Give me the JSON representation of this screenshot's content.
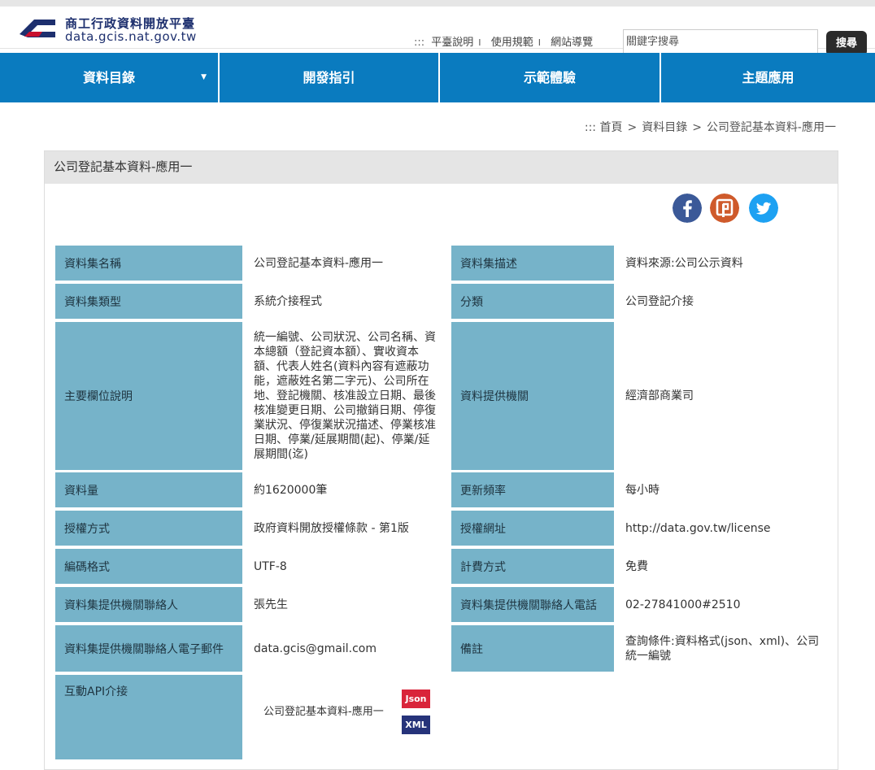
{
  "site": {
    "title": "商工行政資料開放平臺",
    "url": "data.gcis.nat.gov.tw"
  },
  "toplinks": {
    "prefix": ":::",
    "items": [
      "平臺說明",
      "使用規範",
      "網站導覽"
    ],
    "separator": "I"
  },
  "search": {
    "placeholder": "關鍵字搜尋",
    "button": "搜尋"
  },
  "nav": {
    "items": [
      "資料目錄",
      "開發指引",
      "示範體驗",
      "主題應用"
    ],
    "caret": "▼"
  },
  "breadcrumb": {
    "prefix": ":::",
    "items": [
      "首頁",
      "資料目錄",
      "公司登記基本資料-應用一"
    ],
    "separator": ">"
  },
  "panel": {
    "title": "公司登記基本資料-應用一"
  },
  "social": {
    "icons": [
      "facebook-icon",
      "plurk-icon",
      "twitter-icon"
    ],
    "plurk_glyph": "P"
  },
  "rows": [
    {
      "label1": "資料集名稱",
      "value1": "公司登記基本資料-應用一",
      "label2": "資料集描述",
      "value2": "資料來源:公司公示資料"
    },
    {
      "label1": "資料集類型",
      "value1": "系統介接程式",
      "label2": "分類",
      "value2": "公司登記介接"
    },
    {
      "label1": "主要欄位說明",
      "value1": "統一編號、公司狀況、公司名稱、資本總額（登記資本額）、實收資本額、代表人姓名(資料內容有遮蔽功能，遮蔽姓名第二字元)、公司所在地、登記機關、核准設立日期、最後核准變更日期、公司撤銷日期、停復業狀況、停復業狀況描述、停業核准日期、停業/延展期間(起)、停業/延展期間(迄)",
      "label2": "資料提供機關",
      "value2": "經濟部商業司"
    },
    {
      "label1": "資料量",
      "value1": "約1620000筆",
      "label2": "更新頻率",
      "value2": "每小時"
    },
    {
      "label1": "授權方式",
      "value1": "政府資料開放授權條款 - 第1版",
      "label2": "授權網址",
      "value2": "http://data.gov.tw/license"
    },
    {
      "label1": "編碼格式",
      "value1": "UTF-8",
      "label2": "計費方式",
      "value2": "免費"
    },
    {
      "label1": "資料集提供機關聯絡人",
      "value1": "張先生",
      "label2": "資料集提供機關聯絡人電話",
      "value2": "02-27841000#2510"
    },
    {
      "label1": "資料集提供機關聯絡人電子郵件",
      "value1": "data.gcis@gmail.com",
      "label2": "備註",
      "value2": "查詢條件:資料格式(json、xml)、公司統一編號"
    }
  ],
  "api": {
    "label": "互動API介接",
    "item": "公司登記基本資料-應用一",
    "formats": [
      "Json",
      "XML"
    ],
    "colors": {
      "json": "#d9243a",
      "xml": "#26337a"
    }
  },
  "colors": {
    "nav": "#0a7bbf",
    "label_bg": "#76b3c9",
    "panel_head": "#e5e5e5",
    "logo_blue": "#1d2f6e",
    "logo_red": "#c8102e",
    "facebook": "#3b5998",
    "plurk": "#cf5a2b",
    "twitter": "#1da1f2"
  }
}
